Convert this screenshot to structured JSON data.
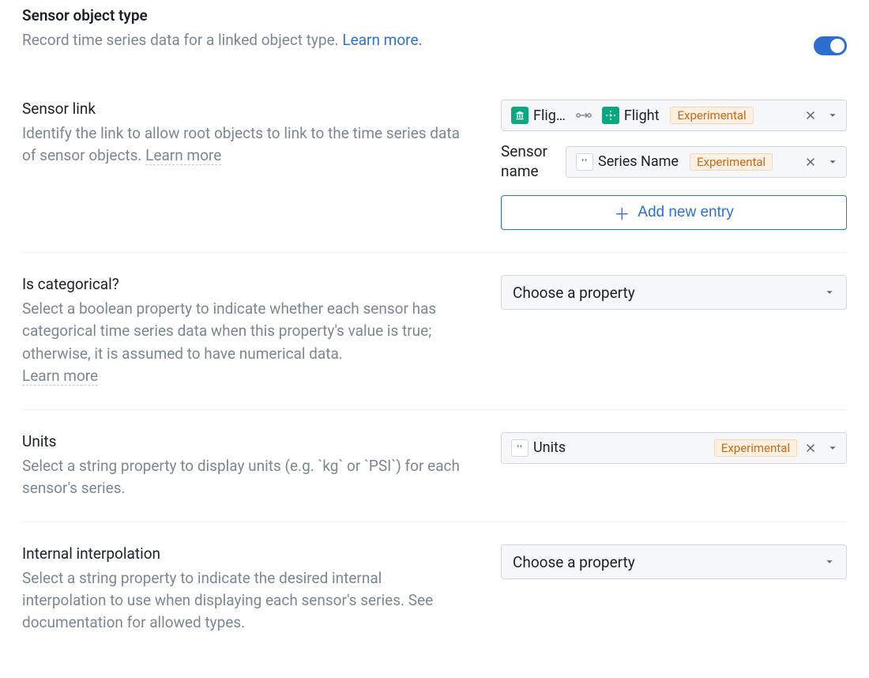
{
  "header": {
    "title": "Sensor object type",
    "desc_prefix": "Record time series data for a linked object type. ",
    "learn_more": "Learn more.",
    "toggle_on": true
  },
  "sensor_link": {
    "label": "Sensor link",
    "desc_prefix": "Identify the link to allow root objects to link to the time series data of sensor objects. ",
    "learn_more": "Learn more",
    "path_source": "Flig…",
    "path_target": "Flight",
    "badge": "Experimental",
    "sensor_name_label": "Sensor name",
    "sensor_name_value": "Series Name",
    "sensor_name_badge": "Experimental",
    "add_entry": "Add new entry"
  },
  "is_categorical": {
    "label": "Is categorical?",
    "desc": "Select a boolean property to indicate whether each sensor has categorical time series data when this property's value is true; otherwise, it is assumed to have numerical data.",
    "learn_more": "Learn more",
    "placeholder": "Choose a property"
  },
  "units": {
    "label": "Units",
    "desc": "Select a string property to display units (e.g. `kg` or `PSI`) for each sensor's series.",
    "value": "Units",
    "badge": "Experimental"
  },
  "interpolation": {
    "label": "Internal interpolation",
    "desc": "Select a string property to indicate the desired internal interpolation to use when displaying each sensor's series. See documentation for allowed types.",
    "placeholder": "Choose a property"
  }
}
